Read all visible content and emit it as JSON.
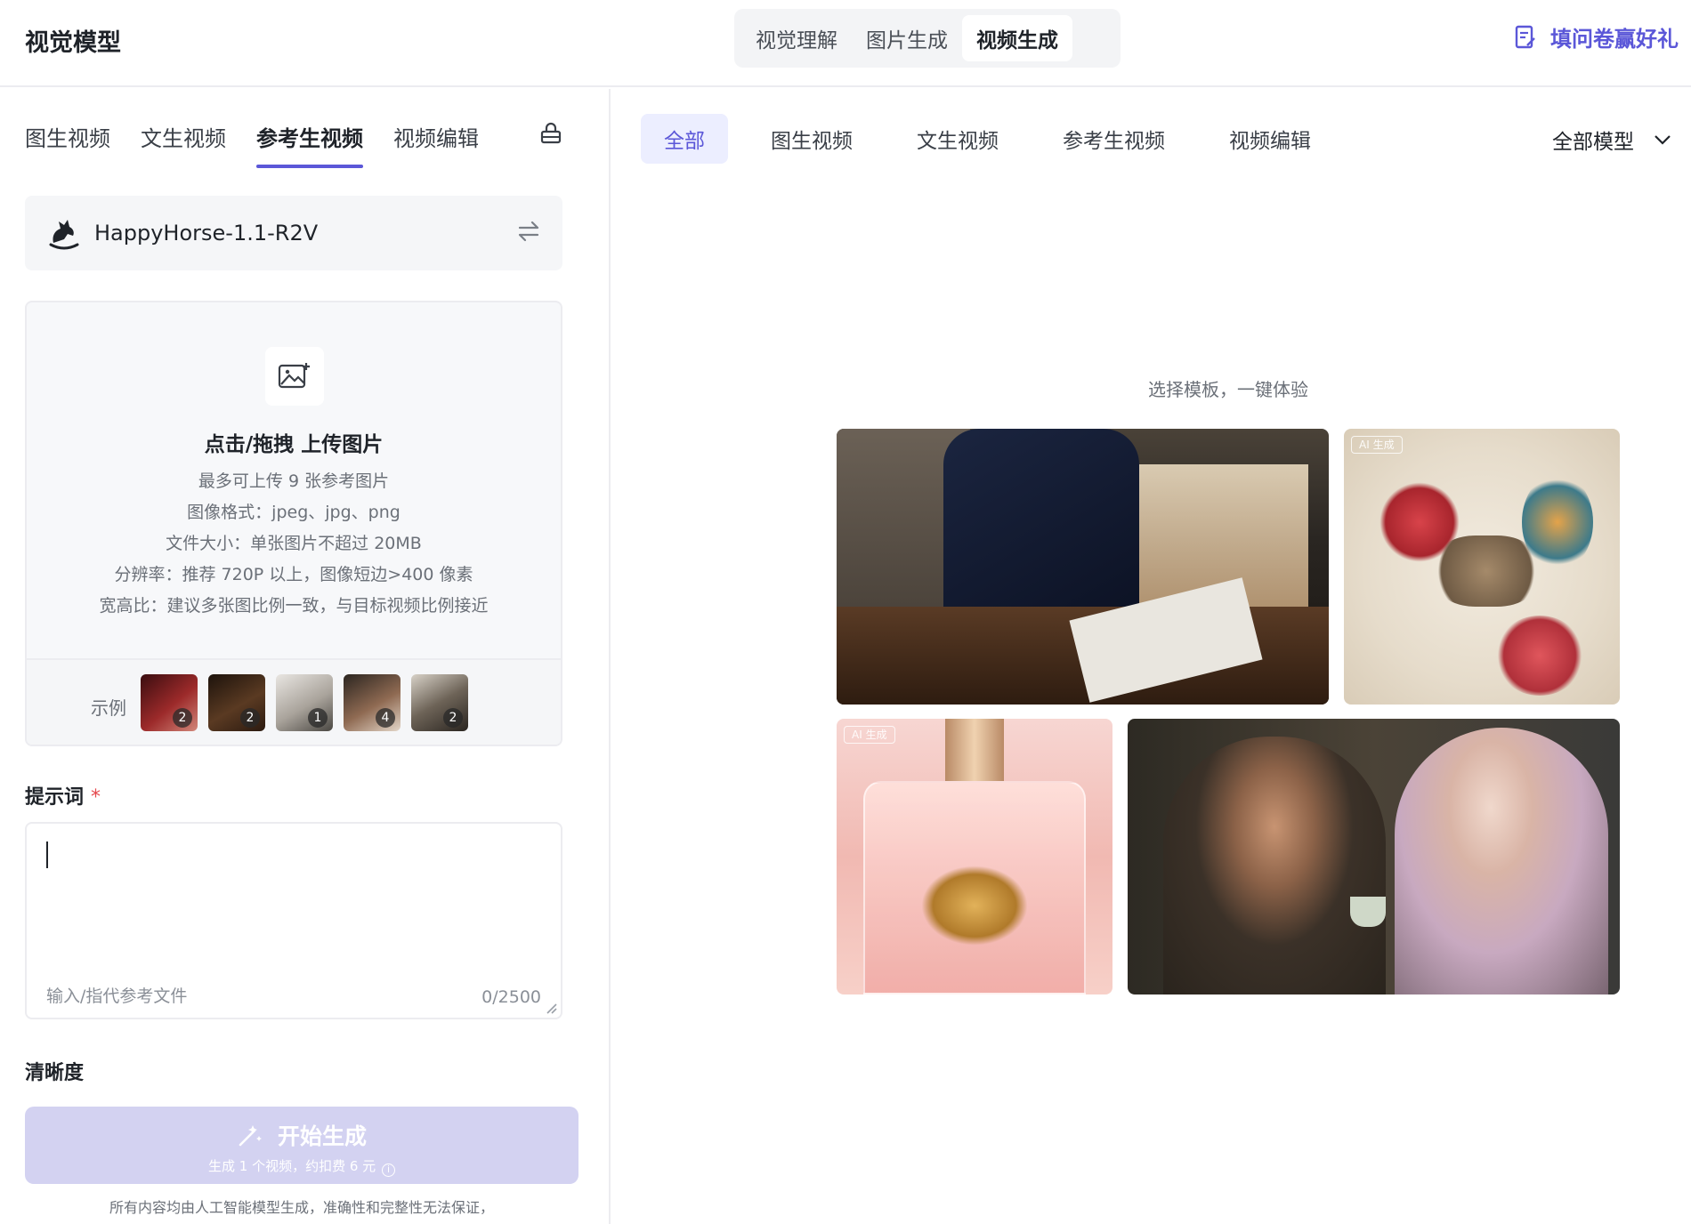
{
  "header": {
    "title": "视觉模型",
    "segments": [
      "视觉理解",
      "图片生成",
      "视频生成"
    ],
    "active_segment": "视频生成",
    "survey_label": "填问卷赢好礼"
  },
  "left_panel": {
    "tabs": [
      "图生视频",
      "文生视频",
      "参考生视频",
      "视频编辑"
    ],
    "active_tab": "参考生视频",
    "model": {
      "name": "HappyHorse-1.1-R2V"
    },
    "upload": {
      "title": "点击/拖拽 上传图片",
      "lines": [
        "最多可上传 9 张参考图片",
        "图像格式：jpeg、jpg、png",
        "文件大小：单张图片不超过 20MB",
        "分辨率：推荐 720P 以上，图像短边>400 像素",
        "宽高比：建议多张图比例一致，与目标视频比例接近"
      ]
    },
    "examples": {
      "label": "示例",
      "items": [
        {
          "count": "2"
        },
        {
          "count": "2"
        },
        {
          "count": "1"
        },
        {
          "count": "4"
        },
        {
          "count": "2"
        }
      ]
    },
    "prompt": {
      "label": "提示词",
      "required_mark": "*",
      "value": "",
      "placeholder": "输入/指代参考文件",
      "counter": "0/2500"
    },
    "clarity_label": "清晰度",
    "generate": {
      "label": "开始生成",
      "sub": "生成 1 个视频，约扣费 6 元"
    },
    "disclaimer": "所有内容均由人工智能模型生成，准确性和完整性无法保证，"
  },
  "right_panel": {
    "filters": [
      "全部",
      "图生视频",
      "文生视频",
      "参考生视频",
      "视频编辑"
    ],
    "active_filter": "全部",
    "model_filter": "全部模型",
    "gallery_title": "选择模板，一键体验",
    "ai_tag": "AI 生成"
  },
  "colors": {
    "accent": "#5b57d8",
    "accent_light": "#eceeff",
    "button_disabled": "#d3d2f1",
    "border": "#ececf0",
    "required": "#e5484d"
  }
}
